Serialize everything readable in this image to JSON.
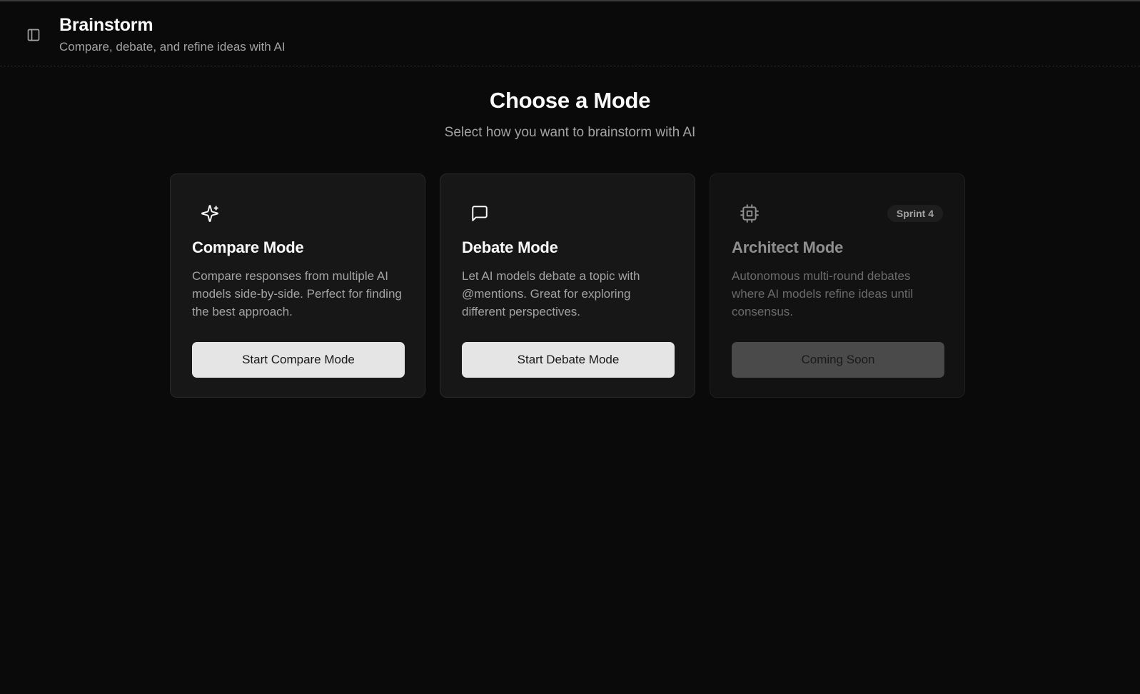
{
  "header": {
    "title": "Brainstorm",
    "subtitle": "Compare, debate, and refine ideas with AI",
    "toggle_icon": "sidebar-panel-icon"
  },
  "main": {
    "title": "Choose a Mode",
    "subtitle": "Select how you want to brainstorm with AI"
  },
  "modes": [
    {
      "icon": "sparkles-icon",
      "title": "Compare Mode",
      "description": "Compare responses from multiple AI models side-by-side. Perfect for finding the best approach.",
      "button_label": "Start Compare Mode",
      "enabled": true
    },
    {
      "icon": "message-square-icon",
      "title": "Debate Mode",
      "description": "Let AI models debate a topic with @mentions. Great for exploring different perspectives.",
      "button_label": "Start Debate Mode",
      "enabled": true
    },
    {
      "icon": "cpu-chip-icon",
      "badge": "Sprint 4",
      "title": "Architect Mode",
      "description": "Autonomous multi-round debates where AI models refine ideas until consensus.",
      "button_label": "Coming Soon",
      "enabled": false
    }
  ],
  "colors": {
    "background": "#0a0a0a",
    "card": "#171717",
    "button": "#e5e5e5",
    "button_disabled": "#4a4a4a"
  }
}
